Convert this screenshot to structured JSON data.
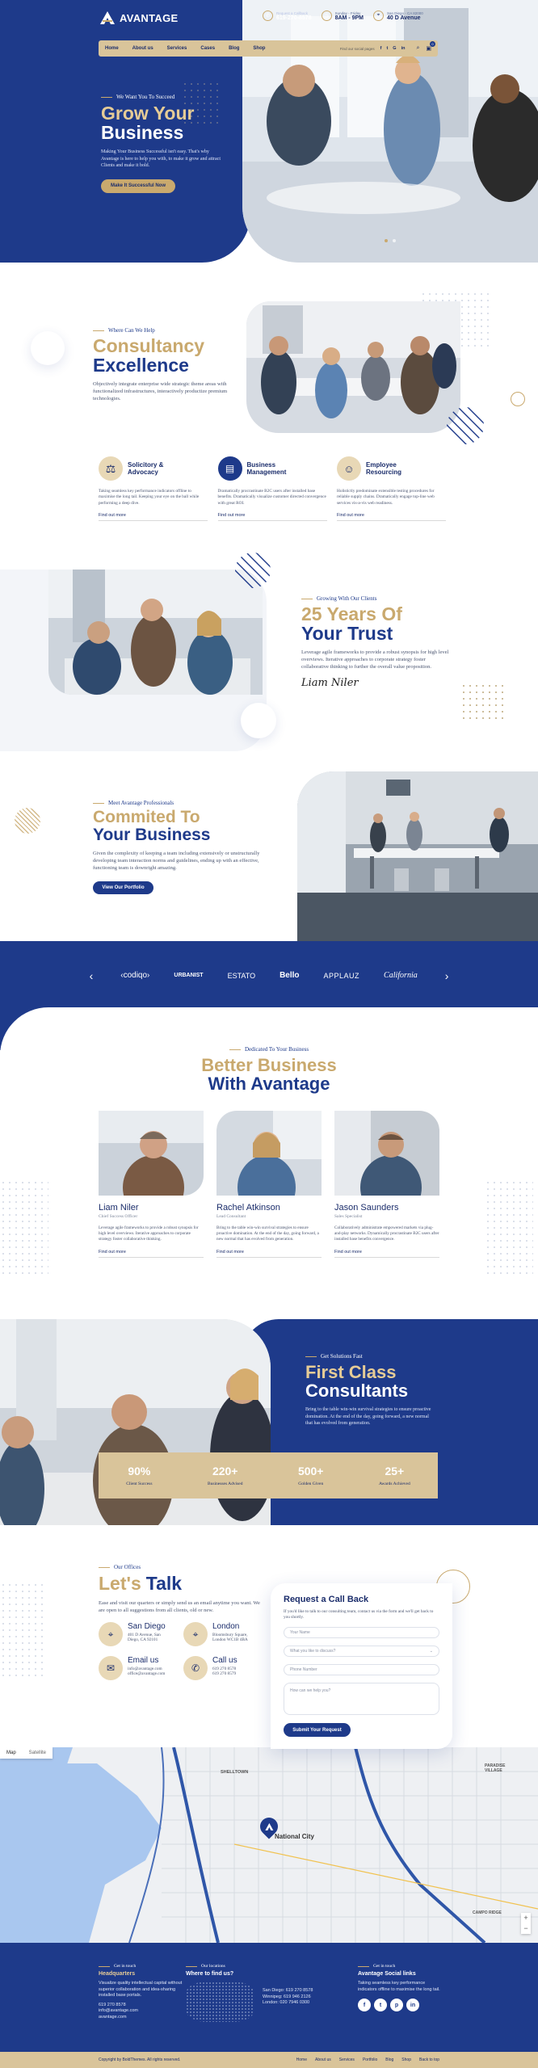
{
  "brand": {
    "name": "AVANTAGE"
  },
  "topbar": [
    {
      "label": "Request a Callback",
      "value": "619-270-8578",
      "icon": "phone-icon"
    },
    {
      "label": "Sunday - Friday",
      "value": "8AM - 9PM",
      "icon": "clock-icon"
    },
    {
      "label": "San Diego - CA 82000",
      "value": "40 D Avenue",
      "icon": "pin-icon"
    }
  ],
  "nav": {
    "items": [
      "Home",
      "About us",
      "Services",
      "Cases",
      "Blog",
      "Shop"
    ],
    "search_placeholder": "Find our social pages",
    "social": [
      "f",
      "t",
      "G",
      "in"
    ],
    "cart_count": "0"
  },
  "hero": {
    "tag": "We Want You To Succeed",
    "title_1": "Grow Your",
    "title_2": "Business",
    "text": "Making Your Business Successful isn't easy. That's why Avantage is here to help you with, to make it grow and attract Clients and make it bold.",
    "button": "Make It Successful Now"
  },
  "consultancy": {
    "tag": "Where Can We Help",
    "title_1": "Consultancy",
    "title_2": "Excellence",
    "text": "Objectively integrate enterprise wide strategic theme areas with functionalized infrastructures, interactively productize premium technologies."
  },
  "services": [
    {
      "title_1": "Solicitory &",
      "title_2": "Advocacy",
      "icon": "scale-icon",
      "text": "Taking seamless key performance indicators offline to maximise the long tail. Keeping your eye on the ball while performing a deep dive.",
      "link": "Find out more"
    },
    {
      "title_1": "Business",
      "title_2": "Management",
      "icon": "briefcase-icon",
      "text": "Dramatically procrastinate B2C users after installed base benefits. Dramatically visualize customer directed convergence with great ROI.",
      "link": "Find out more"
    },
    {
      "title_1": "Employee",
      "title_2": "Resourcing",
      "icon": "team-icon",
      "text": "Holistictly predominate extensible testing procedures for reliable supply chains. Dramatically engage top-line web services vis-a-vis web readiness.",
      "link": "Find out more"
    }
  ],
  "trust": {
    "tag": "Growing With Our Clients",
    "title_1": "25 Years Of",
    "title_2": "Your Trust",
    "text": "Leverage agile frameworks to provide a robust synopsis for high level overviews. Iterative approaches to corporate strategy foster collaborative thinking to further the overall value proposition.",
    "signature": "Liam Niler"
  },
  "committed": {
    "tag": "Meet Avantage Professionals",
    "title_1": "Commited To",
    "title_2": "Your Business",
    "text": "Given the complexity of keeping a team including extensively or unstructurally developing team interaction norms and guidelines, ending up with an effective, functioning team is downright amazing.",
    "button": "View Our Portfolio"
  },
  "partners": {
    "prev": "‹",
    "next": "›",
    "logos": [
      "‹codiqo›",
      "URBANIST",
      "ESTATO",
      "Bello",
      "APPLAUZ",
      "California"
    ]
  },
  "team": {
    "tag": "Dedicated To Your Business",
    "title_1": "Better Business",
    "title_2": "With Avantage",
    "members": [
      {
        "name": "Liam Niler",
        "role": "Chief Success Officer",
        "text": "Leverage agile frameworks to provide a robust synopsis for high level overviews. Iterative approaches to corporate strategy foster collaborative thinking.",
        "link": "Find out more"
      },
      {
        "name": "Rachel Atkinson",
        "role": "Lead Consultant",
        "text": "Bring to the table win-win survival strategies to ensure proactive domination. At the end of the day, going forward, a new normal that has evolved from generation.",
        "link": "Find out more"
      },
      {
        "name": "Jason Saunders",
        "role": "Sales Specialist",
        "text": "Collaboratively administrate empowered markets via plug-and-play networks. Dynamically procrastinate B2C users after installed base benefits convergence.",
        "link": "Find out more"
      }
    ]
  },
  "firstclass": {
    "tag": "Get Solutions Fast",
    "title_1": "First Class",
    "title_2": "Consultants",
    "text": "Bring to the table win-win survival strategies to ensure proactive domination. At the end of the day, going forward, a new normal that has evolved from generation.",
    "stats": [
      {
        "value": "90%",
        "label": "Client Success"
      },
      {
        "value": "220+",
        "label": "Businesses Advised"
      },
      {
        "value": "500+",
        "label": "Golden Given"
      },
      {
        "value": "25+",
        "label": "Awards Achieved"
      }
    ]
  },
  "offices": {
    "tag": "Our Offices",
    "title_1": "Let's",
    "title_2": "Talk",
    "text": "Ease and visit our quarters or simply send us an email anytime you want. We are open to all suggestions from all clients, old or new.",
    "items": [
      {
        "title": "San Diego",
        "line1": "401 D Avenue, San",
        "line2": "Diego, CA 92101",
        "icon": "pin-icon"
      },
      {
        "title": "London",
        "line1": "Bloomsbury Square,",
        "line2": "London WC1B 4BA",
        "icon": "pin-icon"
      },
      {
        "title": "Email us",
        "line1": "info@avantage.com",
        "line2": "office@avantage.com",
        "icon": "mail-icon"
      },
      {
        "title": "Call us",
        "line1": "619 270 8578",
        "line2": "619 270 8579",
        "icon": "phone-icon"
      }
    ]
  },
  "callback": {
    "title": "Request a Call Back",
    "text": "If you'd like to talk to our consulting team, contact us via the form and we'll get back to you shortly.",
    "name_placeholder": "Your Name",
    "topic": "What you like to discuss?",
    "phone_placeholder": "Phone Number",
    "message_placeholder": "How can we help you?",
    "button": "Submit Your Request"
  },
  "map": {
    "tab_map": "Map",
    "tab_satellite": "Satellite",
    "labels": [
      "SHELLTOWN",
      "PARADISE VILLAGE",
      "National City",
      "CAMPO RIDGE"
    ]
  },
  "footer": {
    "col1": {
      "tag": "Get in touch",
      "title": "Headquarters",
      "text": "Visualize quality intellectual capital without superior collaboration and idea-sharing installed base portals.",
      "lines": [
        "619 270 8578",
        "info@avantage.com",
        "avantage.com"
      ]
    },
    "col2": {
      "tag": "Our locations",
      "title": "Where to find us?",
      "offices": [
        "San Diego: 619 270 8578",
        "Winnipeg: 619 946 2126",
        "London: 020 7946 0300"
      ]
    },
    "col3": {
      "tag": "Get in touch",
      "title": "Avantage Social links",
      "text": "Taking seamless key performance indicators offline to maximise the long tail.",
      "social": [
        "f",
        "t",
        "p",
        "in"
      ]
    },
    "copyright": "Copyright by BoldThemes. All rights reserved.",
    "links": [
      "Home",
      "About us",
      "Services",
      "Portfolio",
      "Blog",
      "Shop",
      "Back to top"
    ]
  },
  "colors": {
    "navy": "#1e3a8a",
    "gold": "#c9a96e",
    "white": "#ffffff"
  }
}
